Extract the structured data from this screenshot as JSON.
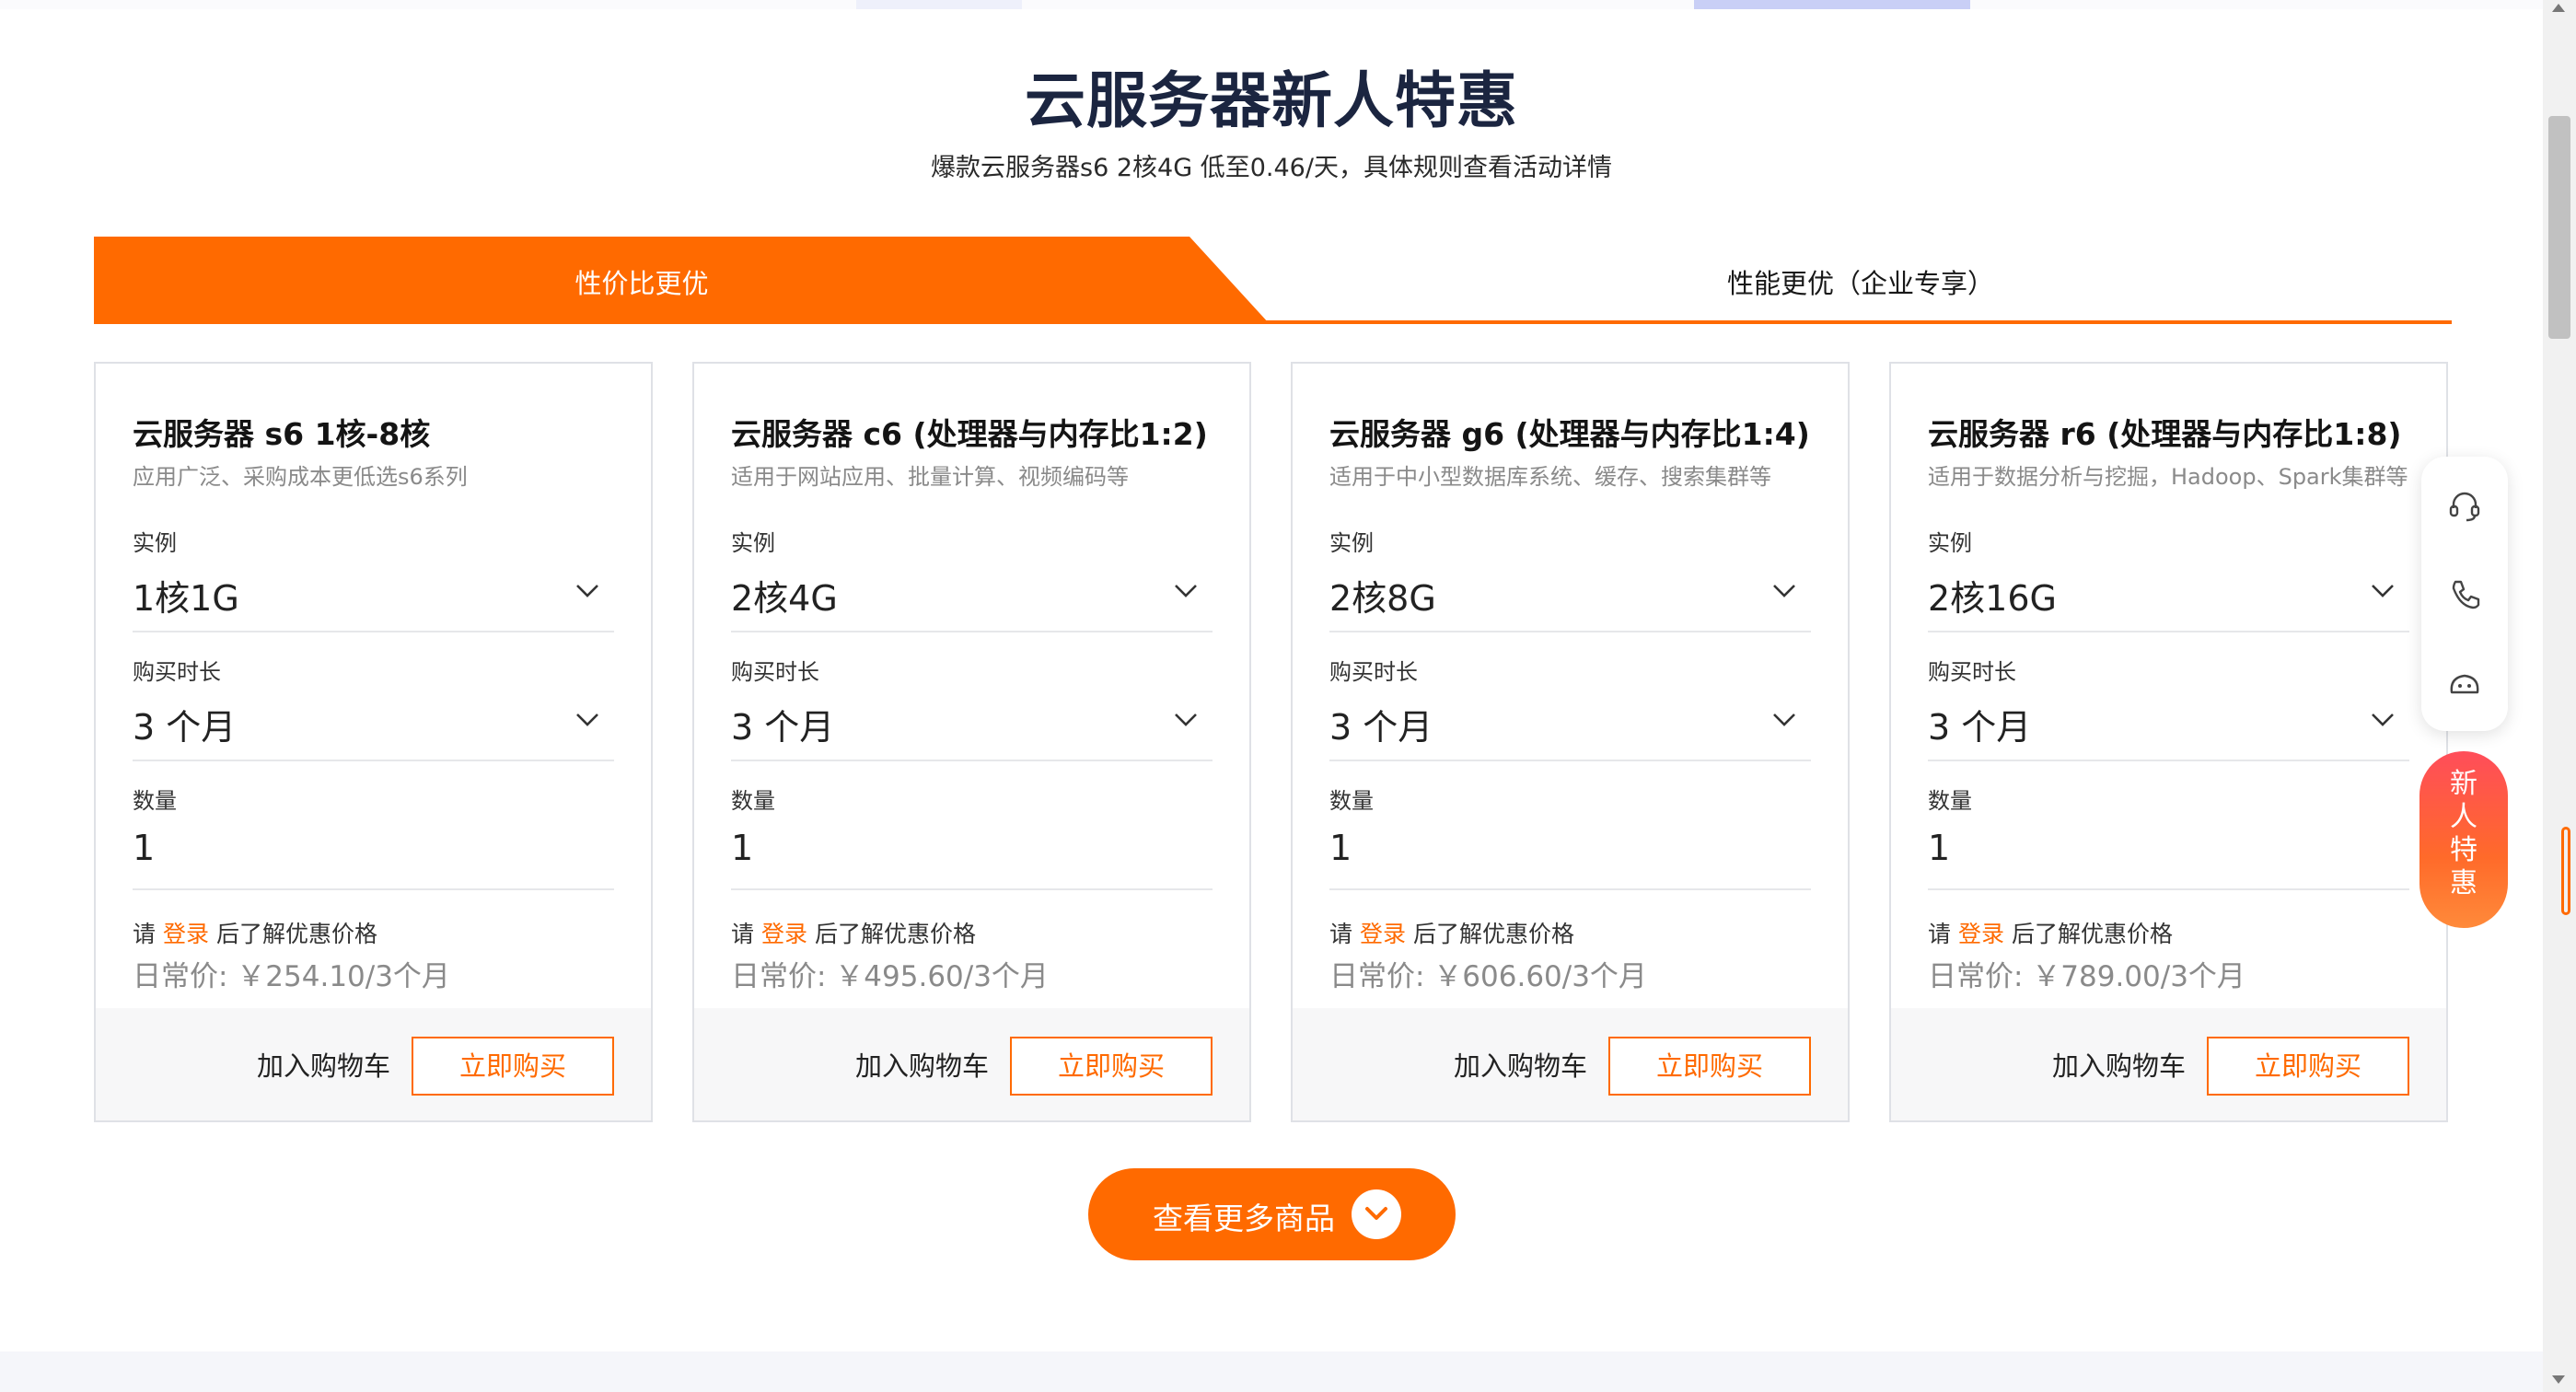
{
  "header": {
    "title": "云服务器新人特惠",
    "subtitle": "爆款云服务器s6 2核4G 低至0.46/天，具体规则查看活动详情"
  },
  "tabs": [
    {
      "label": "性价比更优",
      "active": true
    },
    {
      "label": "性能更优（企业专享）",
      "active": false
    }
  ],
  "labels": {
    "instance": "实例",
    "duration": "购买时长",
    "quantity": "数量",
    "login_prefix": "请",
    "login_link": "登录",
    "login_suffix": "后了解优惠价格",
    "add_to_cart": "加入购物车",
    "buy_now": "立即购买"
  },
  "cards": [
    {
      "title": "云服务器 s6 1核-8核",
      "desc": "应用广泛、采购成本更低选s6系列",
      "instance": "1核1G",
      "duration": "3 个月",
      "quantity": "1",
      "price": "日常价: ￥254.10/3个月"
    },
    {
      "title": "云服务器 c6 (处理器与内存比1:2)",
      "desc": "适用于网站应用、批量计算、视频编码等",
      "instance": "2核4G",
      "duration": "3 个月",
      "quantity": "1",
      "price": "日常价: ￥495.60/3个月"
    },
    {
      "title": "云服务器 g6 (处理器与内存比1:4)",
      "desc": "适用于中小型数据库系统、缓存、搜索集群等",
      "instance": "2核8G",
      "duration": "3 个月",
      "quantity": "1",
      "price": "日常价: ￥606.60/3个月"
    },
    {
      "title": "云服务器 r6 (处理器与内存比1:8)",
      "desc": "适用于数据分析与挖掘，Hadoop、Spark集群等",
      "instance": "2核16G",
      "duration": "3 个月",
      "quantity": "1",
      "price": "日常价: ￥789.00/3个月"
    }
  ],
  "more_button": {
    "label": "查看更多商品"
  },
  "float_panel": {
    "icons": [
      "headset-icon",
      "phone-icon",
      "chat-bot-icon"
    ],
    "promo_label": "新人特惠"
  },
  "colors": {
    "accent": "#ff6a00",
    "title": "#1b2540",
    "muted": "#8a8a8a"
  }
}
